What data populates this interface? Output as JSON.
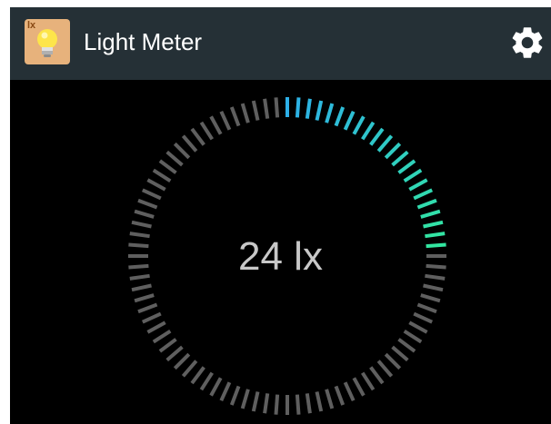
{
  "app_bar": {
    "title": "Light Meter",
    "app_icon_name": "lightbulb-lux-icon",
    "app_icon_badge": "lx",
    "settings_icon_name": "gear-icon"
  },
  "meter": {
    "reading": "24 lx",
    "fill_fraction": 0.25,
    "colors": {
      "inactive": "#5f5f5f",
      "active_start": "#2db0e8",
      "active_end": "#32e6a0"
    }
  }
}
